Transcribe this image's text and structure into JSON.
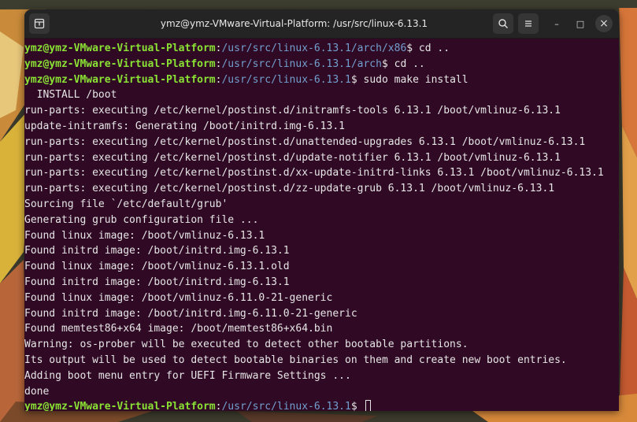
{
  "window": {
    "title": "ymz@ymz-VMware-Virtual-Platform: /usr/src/linux-6.13.1",
    "minimize_glyph": "–",
    "maximize_glyph": "□",
    "close_glyph": "×"
  },
  "terminal": {
    "user_host": "ymz@ymz-VMware-Virtual-Platform",
    "prompt_lines": [
      {
        "path": "/usr/src/linux-6.13.1/arch/x86",
        "command": "$ cd .."
      },
      {
        "path": "/usr/src/linux-6.13.1/arch",
        "command": "$ cd .."
      },
      {
        "path": "/usr/src/linux-6.13.1",
        "command": "$ sudo make install"
      }
    ],
    "output_lines": [
      "  INSTALL /boot",
      "run-parts: executing /etc/kernel/postinst.d/initramfs-tools 6.13.1 /boot/vmlinuz-6.13.1",
      "update-initramfs: Generating /boot/initrd.img-6.13.1",
      "run-parts: executing /etc/kernel/postinst.d/unattended-upgrades 6.13.1 /boot/vmlinuz-6.13.1",
      "run-parts: executing /etc/kernel/postinst.d/update-notifier 6.13.1 /boot/vmlinuz-6.13.1",
      "run-parts: executing /etc/kernel/postinst.d/xx-update-initrd-links 6.13.1 /boot/vmlinuz-6.13.1",
      "run-parts: executing /etc/kernel/postinst.d/zz-update-grub 6.13.1 /boot/vmlinuz-6.13.1",
      "Sourcing file `/etc/default/grub'",
      "Generating grub configuration file ...",
      "Found linux image: /boot/vmlinuz-6.13.1",
      "Found initrd image: /boot/initrd.img-6.13.1",
      "Found linux image: /boot/vmlinuz-6.13.1.old",
      "Found initrd image: /boot/initrd.img-6.13.1",
      "Found linux image: /boot/vmlinuz-6.11.0-21-generic",
      "Found initrd image: /boot/initrd.img-6.11.0-21-generic",
      "Found memtest86+x64 image: /boot/memtest86+x64.bin",
      "Warning: os-prober will be executed to detect other bootable partitions.",
      "Its output will be used to detect bootable binaries on them and create new boot entries.",
      "Adding boot menu entry for UEFI Firmware Settings ...",
      "done"
    ],
    "final_prompt": {
      "path": "/usr/src/linux-6.13.1",
      "command": "$ "
    }
  },
  "colors": {
    "terminal_bg": "#300a24",
    "user_host": "#8ae234",
    "path": "#729fcf",
    "text": "#e6e6e6",
    "titlebar_bg": "#242424"
  },
  "icons": [
    "new-tab-icon",
    "search-icon",
    "hamburger-menu-icon",
    "minimize-icon",
    "maximize-icon",
    "close-icon"
  ]
}
